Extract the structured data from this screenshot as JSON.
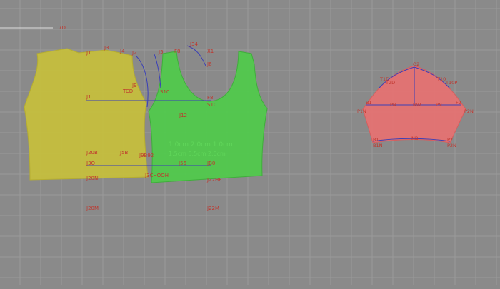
{
  "app": {
    "canvas": {
      "background": "#8a8a8a",
      "grid_color": "#9a9a9a"
    },
    "colors": {
      "back_piece": "#c7bf3b",
      "front_piece": "#4fcb4a",
      "sleeve_piece": "#e57272",
      "construction_line": "#3a3fb7",
      "label_red": "#c0352c",
      "watermark_green": "#60d65a"
    },
    "labels": {
      "top_ref": "7D",
      "j3": "J3",
      "j4": "J4",
      "j1": "J1",
      "j2_left": "J2",
      "j34": "J34",
      "x1": "X1",
      "j5": "J5",
      "f8": "F8",
      "j9": "J9",
      "j6": "J6",
      "t_cd": "TCD",
      "s10": "S10",
      "j12": "J12",
      "j20b": "J20B",
      "j5b": "J5B",
      "j_mid": "J9B92",
      "j_bot_l": "J3O",
      "j56": "J56",
      "jb0": "JB0",
      "j20nh": "J20NH",
      "j30h": "J3CHOOH",
      "j22h": "J22HF",
      "j20m": "J20M",
      "j22m": "J22M",
      "wm1": "1.0cm 2.0cm 1.0cm",
      "wm2": "1.5cm 5.5cm 2.0cm",
      "s_top": "O2",
      "s_tl": "T1D",
      "s_tl2": "T2D",
      "s_tr": "T10",
      "s_tr2": "T10P",
      "s_l": "B1",
      "s_pn_l": "PN",
      "s_nw": "NW",
      "s_pn_r": "PN",
      "s_r": "F2",
      "s_lr": "P1N",
      "s_rr": "P2N",
      "s_bl": "B1",
      "s_bl2": "B1N",
      "s_bm": "NB",
      "s_br": "P2",
      "s_br2": "P2N"
    }
  }
}
